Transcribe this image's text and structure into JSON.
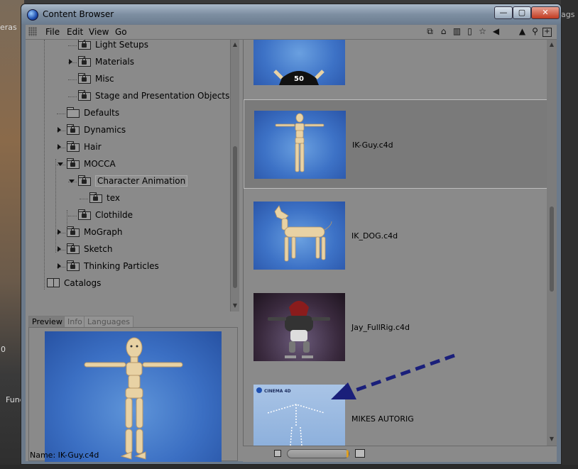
{
  "background": {
    "left_label": "eras",
    "left_zero": "0",
    "left_func": "Func",
    "right_label": "ags"
  },
  "window": {
    "title": "Content Browser",
    "controls": {
      "minimize": "—",
      "maximize": "▢",
      "close": "✕"
    }
  },
  "menu": [
    "File",
    "Edit",
    "View",
    "Go"
  ],
  "toolbar_icons": [
    "stack-icon",
    "home-icon",
    "library-icon",
    "book-icon",
    "star-icon",
    "back-icon",
    "up-icon",
    "search-icon",
    "new-window-icon"
  ],
  "tree": [
    {
      "label": "Light Setups",
      "indent": 2,
      "expander": "none",
      "icon": "locked-folder"
    },
    {
      "label": "Materials",
      "indent": 2,
      "expander": "right",
      "icon": "locked-folder"
    },
    {
      "label": "Misc",
      "indent": 2,
      "expander": "none",
      "icon": "locked-folder"
    },
    {
      "label": "Stage and Presentation Objects",
      "indent": 2,
      "expander": "none",
      "icon": "locked-folder"
    },
    {
      "label": "Defaults",
      "indent": 1,
      "expander": "none",
      "icon": "folder"
    },
    {
      "label": "Dynamics",
      "indent": 1,
      "expander": "right",
      "icon": "locked-folder"
    },
    {
      "label": "Hair",
      "indent": 1,
      "expander": "right",
      "icon": "locked-folder"
    },
    {
      "label": "MOCCA",
      "indent": 1,
      "expander": "down",
      "icon": "open-locked-folder"
    },
    {
      "label": "Character Animation",
      "indent": 2,
      "expander": "down",
      "icon": "open-locked-folder",
      "selected": true
    },
    {
      "label": "tex",
      "indent": 3,
      "expander": "none",
      "icon": "locked-folder"
    },
    {
      "label": "Clothilde",
      "indent": 2,
      "expander": "none",
      "icon": "locked-folder"
    },
    {
      "label": "MoGraph",
      "indent": 1,
      "expander": "right",
      "icon": "locked-folder"
    },
    {
      "label": "Sketch",
      "indent": 1,
      "expander": "right",
      "icon": "locked-folder"
    },
    {
      "label": "Thinking Particles",
      "indent": 1,
      "expander": "right",
      "icon": "locked-folder"
    },
    {
      "label": "Catalogs",
      "indent": 0,
      "expander": "none",
      "icon": "book"
    }
  ],
  "preview_tabs": [
    "Preview",
    "Info",
    "Languages"
  ],
  "preview": {
    "name_label": "Name:",
    "name_value": "IK-Guy.c4d"
  },
  "items": [
    {
      "name": "",
      "badge": "50",
      "thumb": "blue"
    },
    {
      "name": "IK-Guy.c4d",
      "thumb": "blue",
      "selected": true
    },
    {
      "name": "IK_DOG.c4d",
      "thumb": "blue"
    },
    {
      "name": "Jay_FullRig.c4d",
      "thumb": "purple"
    },
    {
      "name": "MIKES AUTORIG",
      "thumb": "light",
      "logo": "CINEMA 4D"
    }
  ],
  "colors": {
    "panel": "#8a8a8a",
    "selection": "#7a7a7a",
    "arrow": "#1a1f7a",
    "slider_accent": "#e0a020"
  }
}
